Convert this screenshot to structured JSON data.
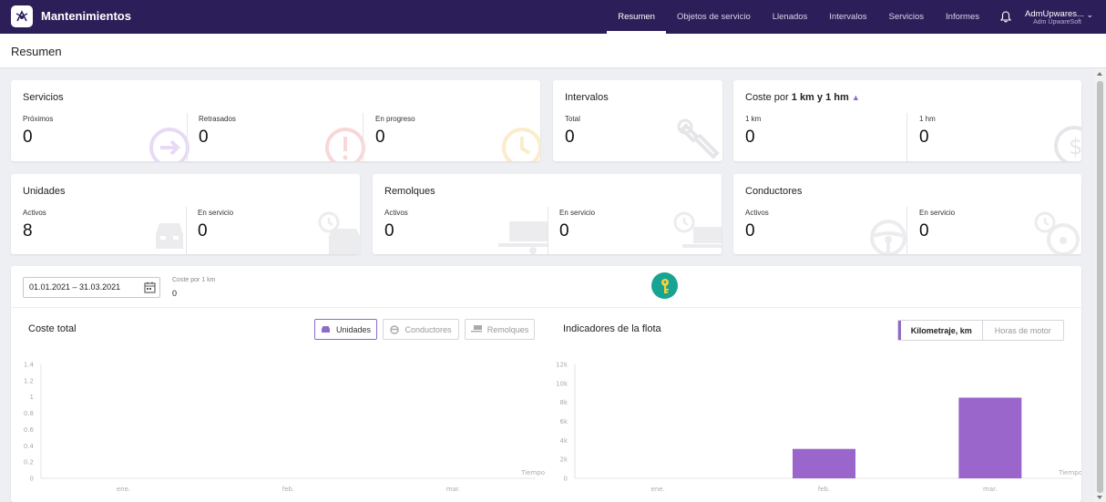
{
  "app": {
    "title": "Mantenimientos"
  },
  "nav": {
    "items": [
      {
        "label": "Resumen",
        "active": true
      },
      {
        "label": "Objetos de servicio"
      },
      {
        "label": "Llenados"
      },
      {
        "label": "Intervalos"
      },
      {
        "label": "Servicios"
      },
      {
        "label": "Informes"
      }
    ],
    "user": {
      "name": "AdmUpwares...",
      "org": "Adm UpwareSoft"
    }
  },
  "page": {
    "title": "Resumen"
  },
  "cards": {
    "servicios": {
      "title": "Servicios",
      "stats": [
        {
          "label": "Próximos",
          "value": "0"
        },
        {
          "label": "Retrasados",
          "value": "0"
        },
        {
          "label": "En progreso",
          "value": "0"
        }
      ]
    },
    "intervalos": {
      "title": "Intervalos",
      "stats": [
        {
          "label": "Total",
          "value": "0"
        }
      ]
    },
    "coste": {
      "title": "Coste por",
      "title_bold": "1 km y 1 hm",
      "stats": [
        {
          "label": "1 km",
          "value": "0"
        },
        {
          "label": "1 hm",
          "value": "0"
        }
      ]
    },
    "unidades": {
      "title": "Unidades",
      "stats": [
        {
          "label": "Activos",
          "value": "8"
        },
        {
          "label": "En servicio",
          "value": "0"
        }
      ]
    },
    "remolques": {
      "title": "Remolques",
      "stats": [
        {
          "label": "Activos",
          "value": "0"
        },
        {
          "label": "En servicio",
          "value": "0"
        }
      ]
    },
    "conductores": {
      "title": "Conductores",
      "stats": [
        {
          "label": "Activos",
          "value": "0"
        },
        {
          "label": "En servicio",
          "value": "0"
        }
      ]
    }
  },
  "filters": {
    "date_range": "01.01.2021 – 31.03.2021",
    "cost_per_km_label": "Coste por 1 km",
    "cost_per_km_value": "0"
  },
  "cost_section": {
    "title": "Coste total",
    "buttons": {
      "unidades": "Unidades",
      "conductores": "Conductores",
      "remolques": "Remolques"
    }
  },
  "fleet_section": {
    "title": "Indicadores de la flota",
    "toggle": {
      "kilometraje": "Kilometraje, km",
      "horas": "Horas de motor"
    }
  },
  "colors": {
    "accent": "#8f6bc7",
    "bar": "#9a66cc",
    "topbar": "#2c1f59",
    "key": "#18a392"
  },
  "chart_data": [
    {
      "type": "bar",
      "title": "Coste total",
      "categories": [
        "ene.",
        "feb.",
        "mar."
      ],
      "values": [
        0,
        0,
        0
      ],
      "ylim": [
        0,
        1.4
      ],
      "yticks": [
        "0",
        "0.2",
        "0.4",
        "0.6",
        "0.8",
        "1",
        "1.2",
        "1.4"
      ],
      "xlabel": "Tiempo",
      "ylabel": ""
    },
    {
      "type": "bar",
      "title": "Indicadores de la flota",
      "categories": [
        "ene.",
        "feb.",
        "mar."
      ],
      "values": [
        0,
        3100,
        8500
      ],
      "ylim": [
        0,
        12000
      ],
      "yticks": [
        "0",
        "2k",
        "4k",
        "6k",
        "8k",
        "10k",
        "12k"
      ],
      "xlabel": "Tiempo",
      "ylabel": ""
    }
  ]
}
